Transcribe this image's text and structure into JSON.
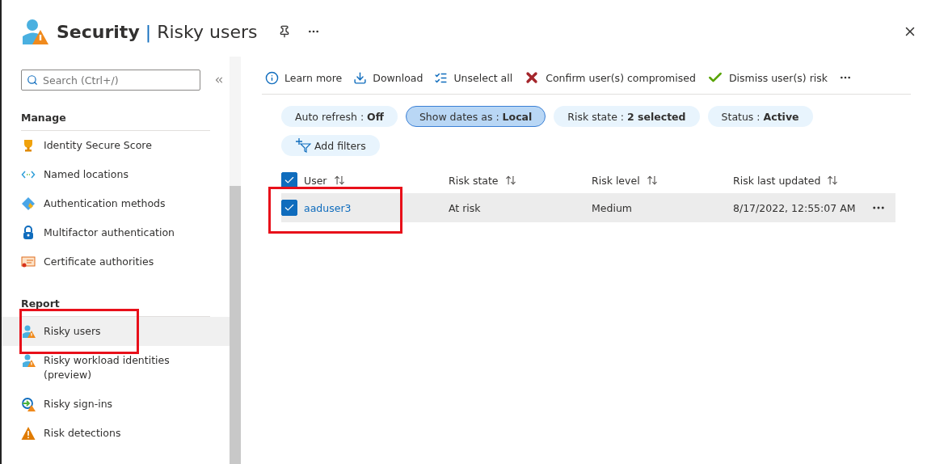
{
  "header": {
    "title": "Security",
    "separator": "|",
    "subtitle": "Risky users"
  },
  "sidebar": {
    "search": {
      "placeholder": "Search (Ctrl+/)"
    },
    "sections": [
      {
        "heading": "Manage",
        "items": [
          {
            "label": "Identity Secure Score",
            "selected": false,
            "highlighted": false
          },
          {
            "label": "Named locations",
            "selected": false,
            "highlighted": false
          },
          {
            "label": "Authentication methods",
            "selected": false,
            "highlighted": false
          },
          {
            "label": "Multifactor authentication",
            "selected": false,
            "highlighted": false
          },
          {
            "label": "Certificate authorities",
            "selected": false,
            "highlighted": false
          }
        ]
      },
      {
        "heading": "Report",
        "items": [
          {
            "label": "Risky users",
            "selected": true,
            "highlighted": true
          },
          {
            "label": "Risky workload identities (preview)",
            "selected": false,
            "highlighted": false
          },
          {
            "label": "Risky sign-ins",
            "selected": false,
            "highlighted": false
          },
          {
            "label": "Risk detections",
            "selected": false,
            "highlighted": false
          }
        ]
      }
    ]
  },
  "toolbar": [
    {
      "label": "Learn more"
    },
    {
      "label": "Download"
    },
    {
      "label": "Unselect all"
    },
    {
      "label": "Confirm user(s) compromised"
    },
    {
      "label": "Dismiss user(s) risk"
    }
  ],
  "filters": [
    {
      "name": "Auto refresh : ",
      "value": "Off",
      "selected": false
    },
    {
      "name": "Show dates as : ",
      "value": "Local",
      "selected": true
    },
    {
      "name": "Risk state : ",
      "value": "2 selected",
      "selected": false
    },
    {
      "name": "Status : ",
      "value": "Active",
      "selected": false
    }
  ],
  "add_filters": "Add filters",
  "table": {
    "all_checked": true,
    "columns": [
      "User",
      "Risk state",
      "Risk level",
      "Risk last updated"
    ],
    "rows": [
      {
        "cells": [
          "aaduser3",
          "At risk",
          "Medium",
          "8/17/2022, 12:55:07 AM"
        ],
        "checked": true,
        "highlighted": true
      }
    ]
  }
}
